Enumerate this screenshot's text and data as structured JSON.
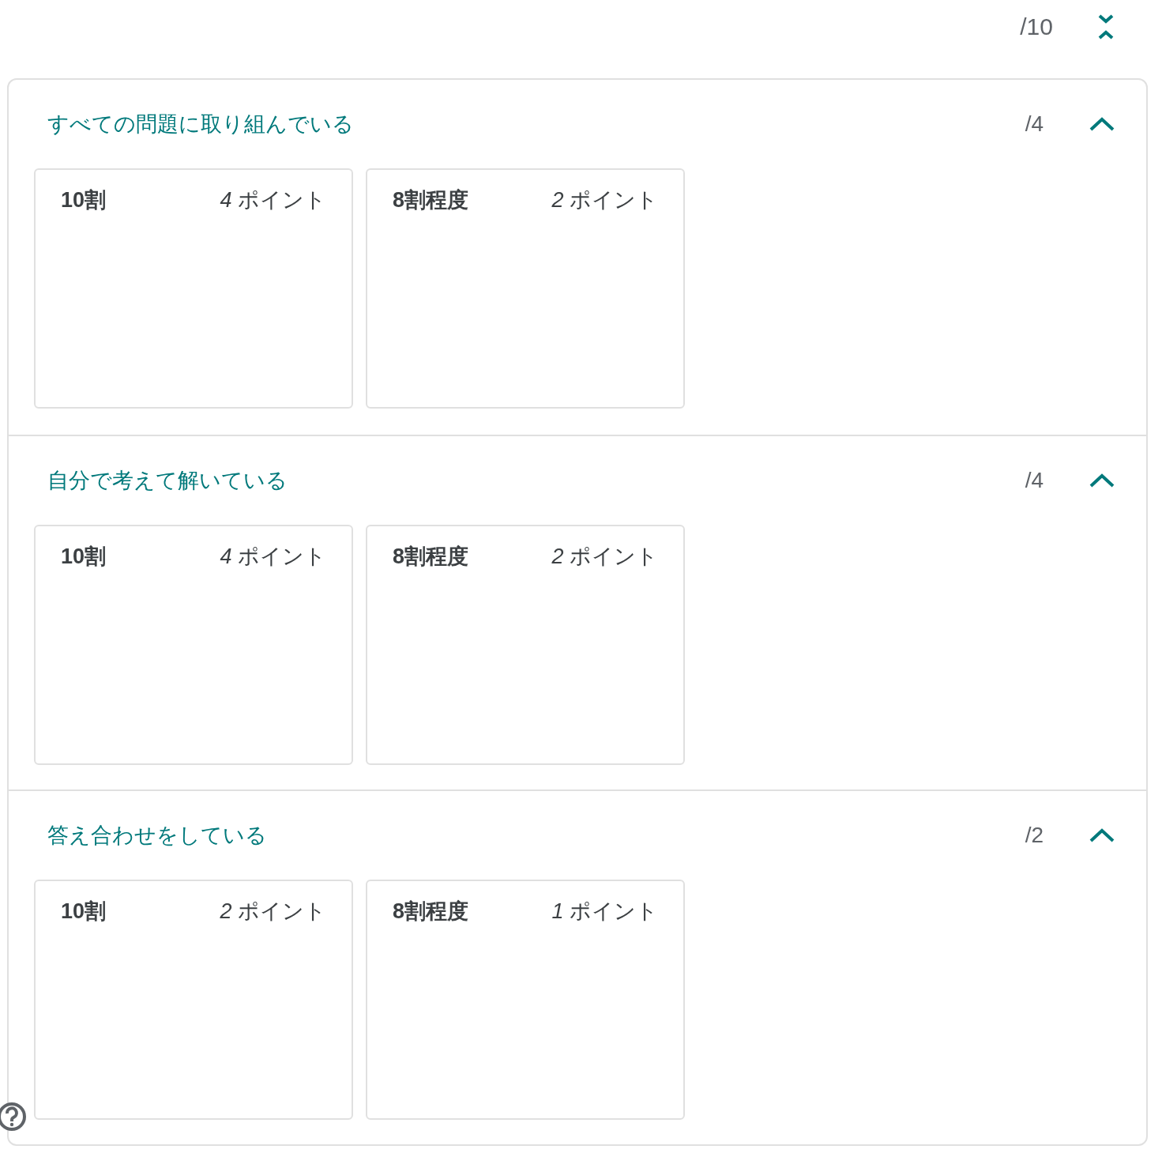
{
  "total": {
    "score": "/10"
  },
  "criteria": [
    {
      "title": "すべての問題に取り組んでいる",
      "score": "/4",
      "expanded": true,
      "levels": [
        {
          "label": "10割",
          "points": "*4* ポイント"
        },
        {
          "label": "8割程度",
          "points": "*2* ポイント"
        }
      ]
    },
    {
      "title": "自分で考えて解いている",
      "score": "/4",
      "expanded": true,
      "levels": [
        {
          "label": "10割",
          "points": "*4* ポイント"
        },
        {
          "label": "8割程度",
          "points": "*2* ポイント"
        }
      ]
    },
    {
      "title": "答え合わせをしている",
      "score": "/2",
      "expanded": true,
      "levels": [
        {
          "label": "10割",
          "points": "*2* ポイント"
        },
        {
          "label": "8割程度",
          "points": "*1* ポイント"
        }
      ]
    }
  ]
}
